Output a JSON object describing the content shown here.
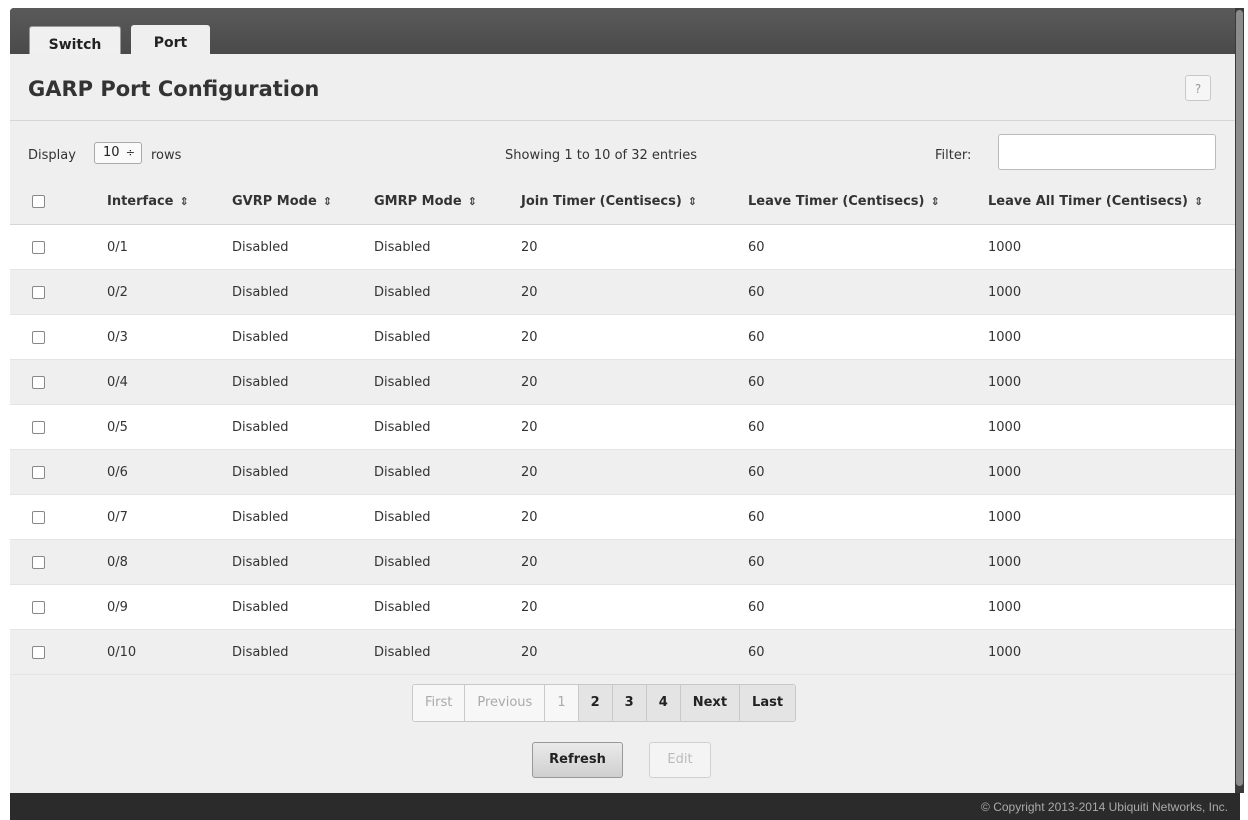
{
  "tabs": [
    {
      "label": "Switch"
    },
    {
      "label": "Port"
    }
  ],
  "page": {
    "title": "GARP Port Configuration",
    "help_label": "?"
  },
  "controls": {
    "display_label": "Display",
    "rows_value": "10",
    "rows_arrows": "÷",
    "rows_label": "rows",
    "showing": "Showing 1 to 10 of 32 entries",
    "filter_label": "Filter:",
    "filter_value": ""
  },
  "table": {
    "sort_glyph": "⇕",
    "columns": [
      "Interface",
      "GVRP Mode",
      "GMRP Mode",
      "Join Timer (Centisecs)",
      "Leave Timer (Centisecs)",
      "Leave All Timer (Centisecs)"
    ],
    "rows": [
      [
        "0/1",
        "Disabled",
        "Disabled",
        "20",
        "60",
        "1000"
      ],
      [
        "0/2",
        "Disabled",
        "Disabled",
        "20",
        "60",
        "1000"
      ],
      [
        "0/3",
        "Disabled",
        "Disabled",
        "20",
        "60",
        "1000"
      ],
      [
        "0/4",
        "Disabled",
        "Disabled",
        "20",
        "60",
        "1000"
      ],
      [
        "0/5",
        "Disabled",
        "Disabled",
        "20",
        "60",
        "1000"
      ],
      [
        "0/6",
        "Disabled",
        "Disabled",
        "20",
        "60",
        "1000"
      ],
      [
        "0/7",
        "Disabled",
        "Disabled",
        "20",
        "60",
        "1000"
      ],
      [
        "0/8",
        "Disabled",
        "Disabled",
        "20",
        "60",
        "1000"
      ],
      [
        "0/9",
        "Disabled",
        "Disabled",
        "20",
        "60",
        "1000"
      ],
      [
        "0/10",
        "Disabled",
        "Disabled",
        "20",
        "60",
        "1000"
      ]
    ]
  },
  "pagination": {
    "first": "First",
    "previous": "Previous",
    "pages": [
      "1",
      "2",
      "3",
      "4"
    ],
    "current_page": "1",
    "next": "Next",
    "last": "Last"
  },
  "buttons": {
    "refresh": "Refresh",
    "edit": "Edit"
  },
  "footer": {
    "copyright": "© Copyright 2013-2014 Ubiquiti Networks, Inc."
  }
}
